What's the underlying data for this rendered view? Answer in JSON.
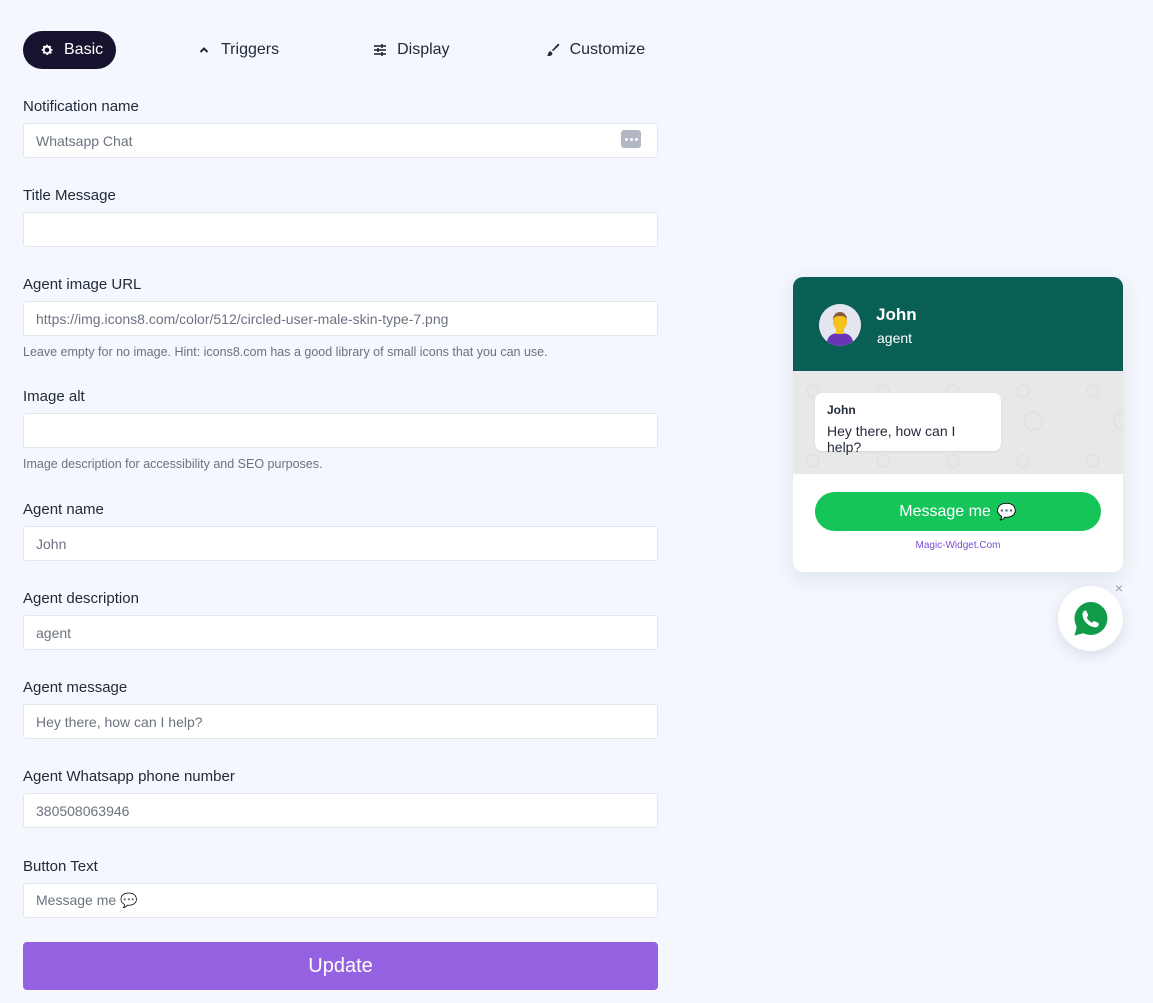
{
  "tabs": [
    {
      "label": "Basic",
      "icon": "gear-icon",
      "active": true
    },
    {
      "label": "Triggers",
      "icon": "chevron-up-icon",
      "active": false
    },
    {
      "label": "Display",
      "icon": "sliders-icon",
      "active": false
    },
    {
      "label": "Customize",
      "icon": "brush-icon",
      "active": false
    }
  ],
  "form": {
    "notification_name": {
      "label": "Notification name",
      "value": "Whatsapp Chat"
    },
    "title_message": {
      "label": "Title Message",
      "value": ""
    },
    "agent_image_url": {
      "label": "Agent image URL",
      "value": "https://img.icons8.com/color/512/circled-user-male-skin-type-7.png",
      "hint": "Leave empty for no image. Hint: icons8.com has a good library of small icons that you can use."
    },
    "image_alt": {
      "label": "Image alt",
      "value": "",
      "hint": "Image description for accessibility and SEO purposes."
    },
    "agent_name": {
      "label": "Agent name",
      "value": "John"
    },
    "agent_description": {
      "label": "Agent description",
      "value": "agent"
    },
    "agent_message": {
      "label": "Agent message",
      "value": "Hey there, how can I help?"
    },
    "agent_phone": {
      "label": "Agent Whatsapp phone number",
      "value": "380508063946"
    },
    "button_text": {
      "label": "Button Text",
      "value": "Message me 💬"
    },
    "update_label": "Update"
  },
  "preview": {
    "agent_name": "John",
    "agent_description": "agent",
    "bubble_name": "John",
    "bubble_message": "Hey there, how can I help?",
    "button_label": "Message me",
    "button_emoji": "💬",
    "branding": "Magic-Widget.Com",
    "close_symbol": "×"
  },
  "colors": {
    "header": "#0a5f55",
    "button": "#16c55a",
    "update": "#9461e0",
    "active_tab": "#17132e"
  }
}
